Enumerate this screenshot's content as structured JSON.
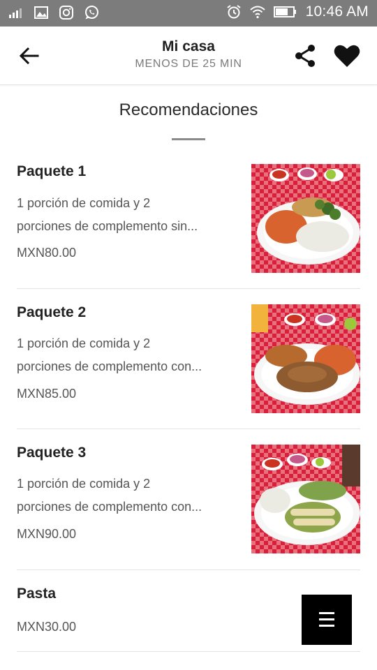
{
  "status_bar": {
    "time": "10:46 AM",
    "icons": [
      "signal-icon",
      "image-icon",
      "instagram-icon",
      "whatsapp-icon",
      "alarm-icon",
      "wifi-icon",
      "battery-icon"
    ]
  },
  "header": {
    "title": "Mi casa",
    "subtitle": "MENOS DE 25 MIN",
    "icons": [
      "back-arrow-icon",
      "share-icon",
      "heart-icon"
    ]
  },
  "section": {
    "title": "Recomendaciones"
  },
  "items": [
    {
      "name": "Paquete 1",
      "desc_line1": "1 porción de comida y 2",
      "desc_line2": "porciones de complemento sin...",
      "price": "MXN80.00",
      "photo": "food-plate"
    },
    {
      "name": "Paquete 2",
      "desc_line1": "1 porción de comida y 2",
      "desc_line2": "porciones de complemento con...",
      "price": "MXN85.00",
      "photo": "food-plate"
    },
    {
      "name": "Paquete 3",
      "desc_line1": "1 porción de comida y 2",
      "desc_line2": "porciones de complemento con...",
      "price": "MXN90.00",
      "photo": "food-plate"
    },
    {
      "name": "Pasta",
      "price": "MXN30.00"
    }
  ],
  "fab": {
    "icon": "menu-icon"
  },
  "colors": {
    "status_bar": "#7c7c7c",
    "text_primary": "#222222",
    "text_secondary": "#555555",
    "divider": "#e3e3e3",
    "fab": "#000000",
    "tablecloth": "#d8203a"
  }
}
